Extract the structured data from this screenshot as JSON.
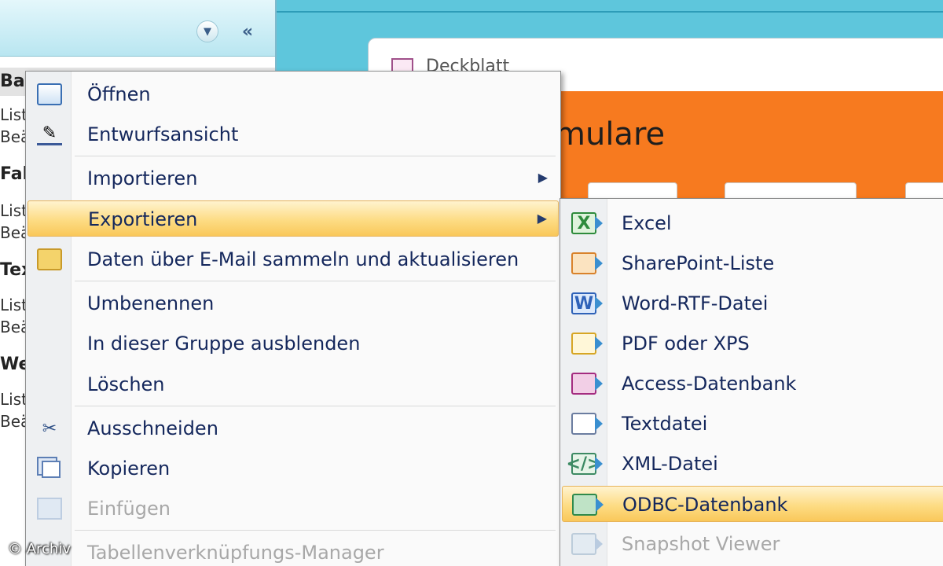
{
  "nav": {
    "groups": [
      {
        "label": "Basc",
        "items": [
          "Liste",
          "Beär"
        ]
      },
      {
        "label": "Fahr",
        "items": [
          "Liste",
          "Beär"
        ]
      },
      {
        "label": "Text",
        "items": [
          "Liste",
          "Beär"
        ]
      },
      {
        "label": "Wein",
        "items": [
          "Liste",
          "Beär"
        ]
      }
    ]
  },
  "document": {
    "tab_label": "Deckblatt",
    "form_title": "mulare"
  },
  "context_menu": {
    "items": [
      {
        "label": "Öffnen",
        "icon": "open-icon"
      },
      {
        "label": "Entwurfsansicht",
        "icon": "design-view-icon"
      },
      {
        "label": "Importieren",
        "submenu": true
      },
      {
        "label": "Exportieren",
        "submenu": true,
        "highlighted": true
      },
      {
        "label": "Daten über E-Mail sammeln und aktualisieren",
        "icon": "collect-data-icon"
      },
      {
        "label": "Umbenennen"
      },
      {
        "label": "In dieser Gruppe ausblenden"
      },
      {
        "label": "Löschen"
      },
      {
        "label": "Ausschneiden",
        "icon": "scissors-icon"
      },
      {
        "label": "Kopieren",
        "icon": "copy-icon"
      },
      {
        "label": "Einfügen",
        "icon": "paste-icon",
        "disabled": true
      },
      {
        "label": "Tabellenverknüpfungs-Manager",
        "disabled": true
      }
    ],
    "arrow_glyph": "▶"
  },
  "export_submenu": {
    "items": [
      {
        "label": "Excel",
        "icon": "excel-icon",
        "glyph": "X"
      },
      {
        "label": "SharePoint-Liste",
        "icon": "sharepoint-list-icon",
        "glyph": ""
      },
      {
        "label": "Word-RTF-Datei",
        "icon": "word-rtf-icon",
        "glyph": "W"
      },
      {
        "label": "PDF oder XPS",
        "icon": "pdf-xps-icon",
        "glyph": ""
      },
      {
        "label": "Access-Datenbank",
        "icon": "access-database-icon",
        "glyph": ""
      },
      {
        "label": "Textdatei",
        "icon": "text-file-icon",
        "glyph": ""
      },
      {
        "label": "XML-Datei",
        "icon": "xml-file-icon",
        "glyph": "</>"
      },
      {
        "label": "ODBC-Datenbank",
        "icon": "odbc-database-icon",
        "glyph": "",
        "highlighted": true
      },
      {
        "label": "Snapshot Viewer",
        "icon": "snapshot-viewer-icon",
        "glyph": "",
        "disabled": true
      }
    ]
  },
  "watermark": "© Archiv",
  "colors": {
    "highlight": "#fddc84",
    "menu_text": "#14275c",
    "disabled_text": "#a8a8a8",
    "form_header": "#f77a1f",
    "workspace": "#5ec6dc"
  }
}
